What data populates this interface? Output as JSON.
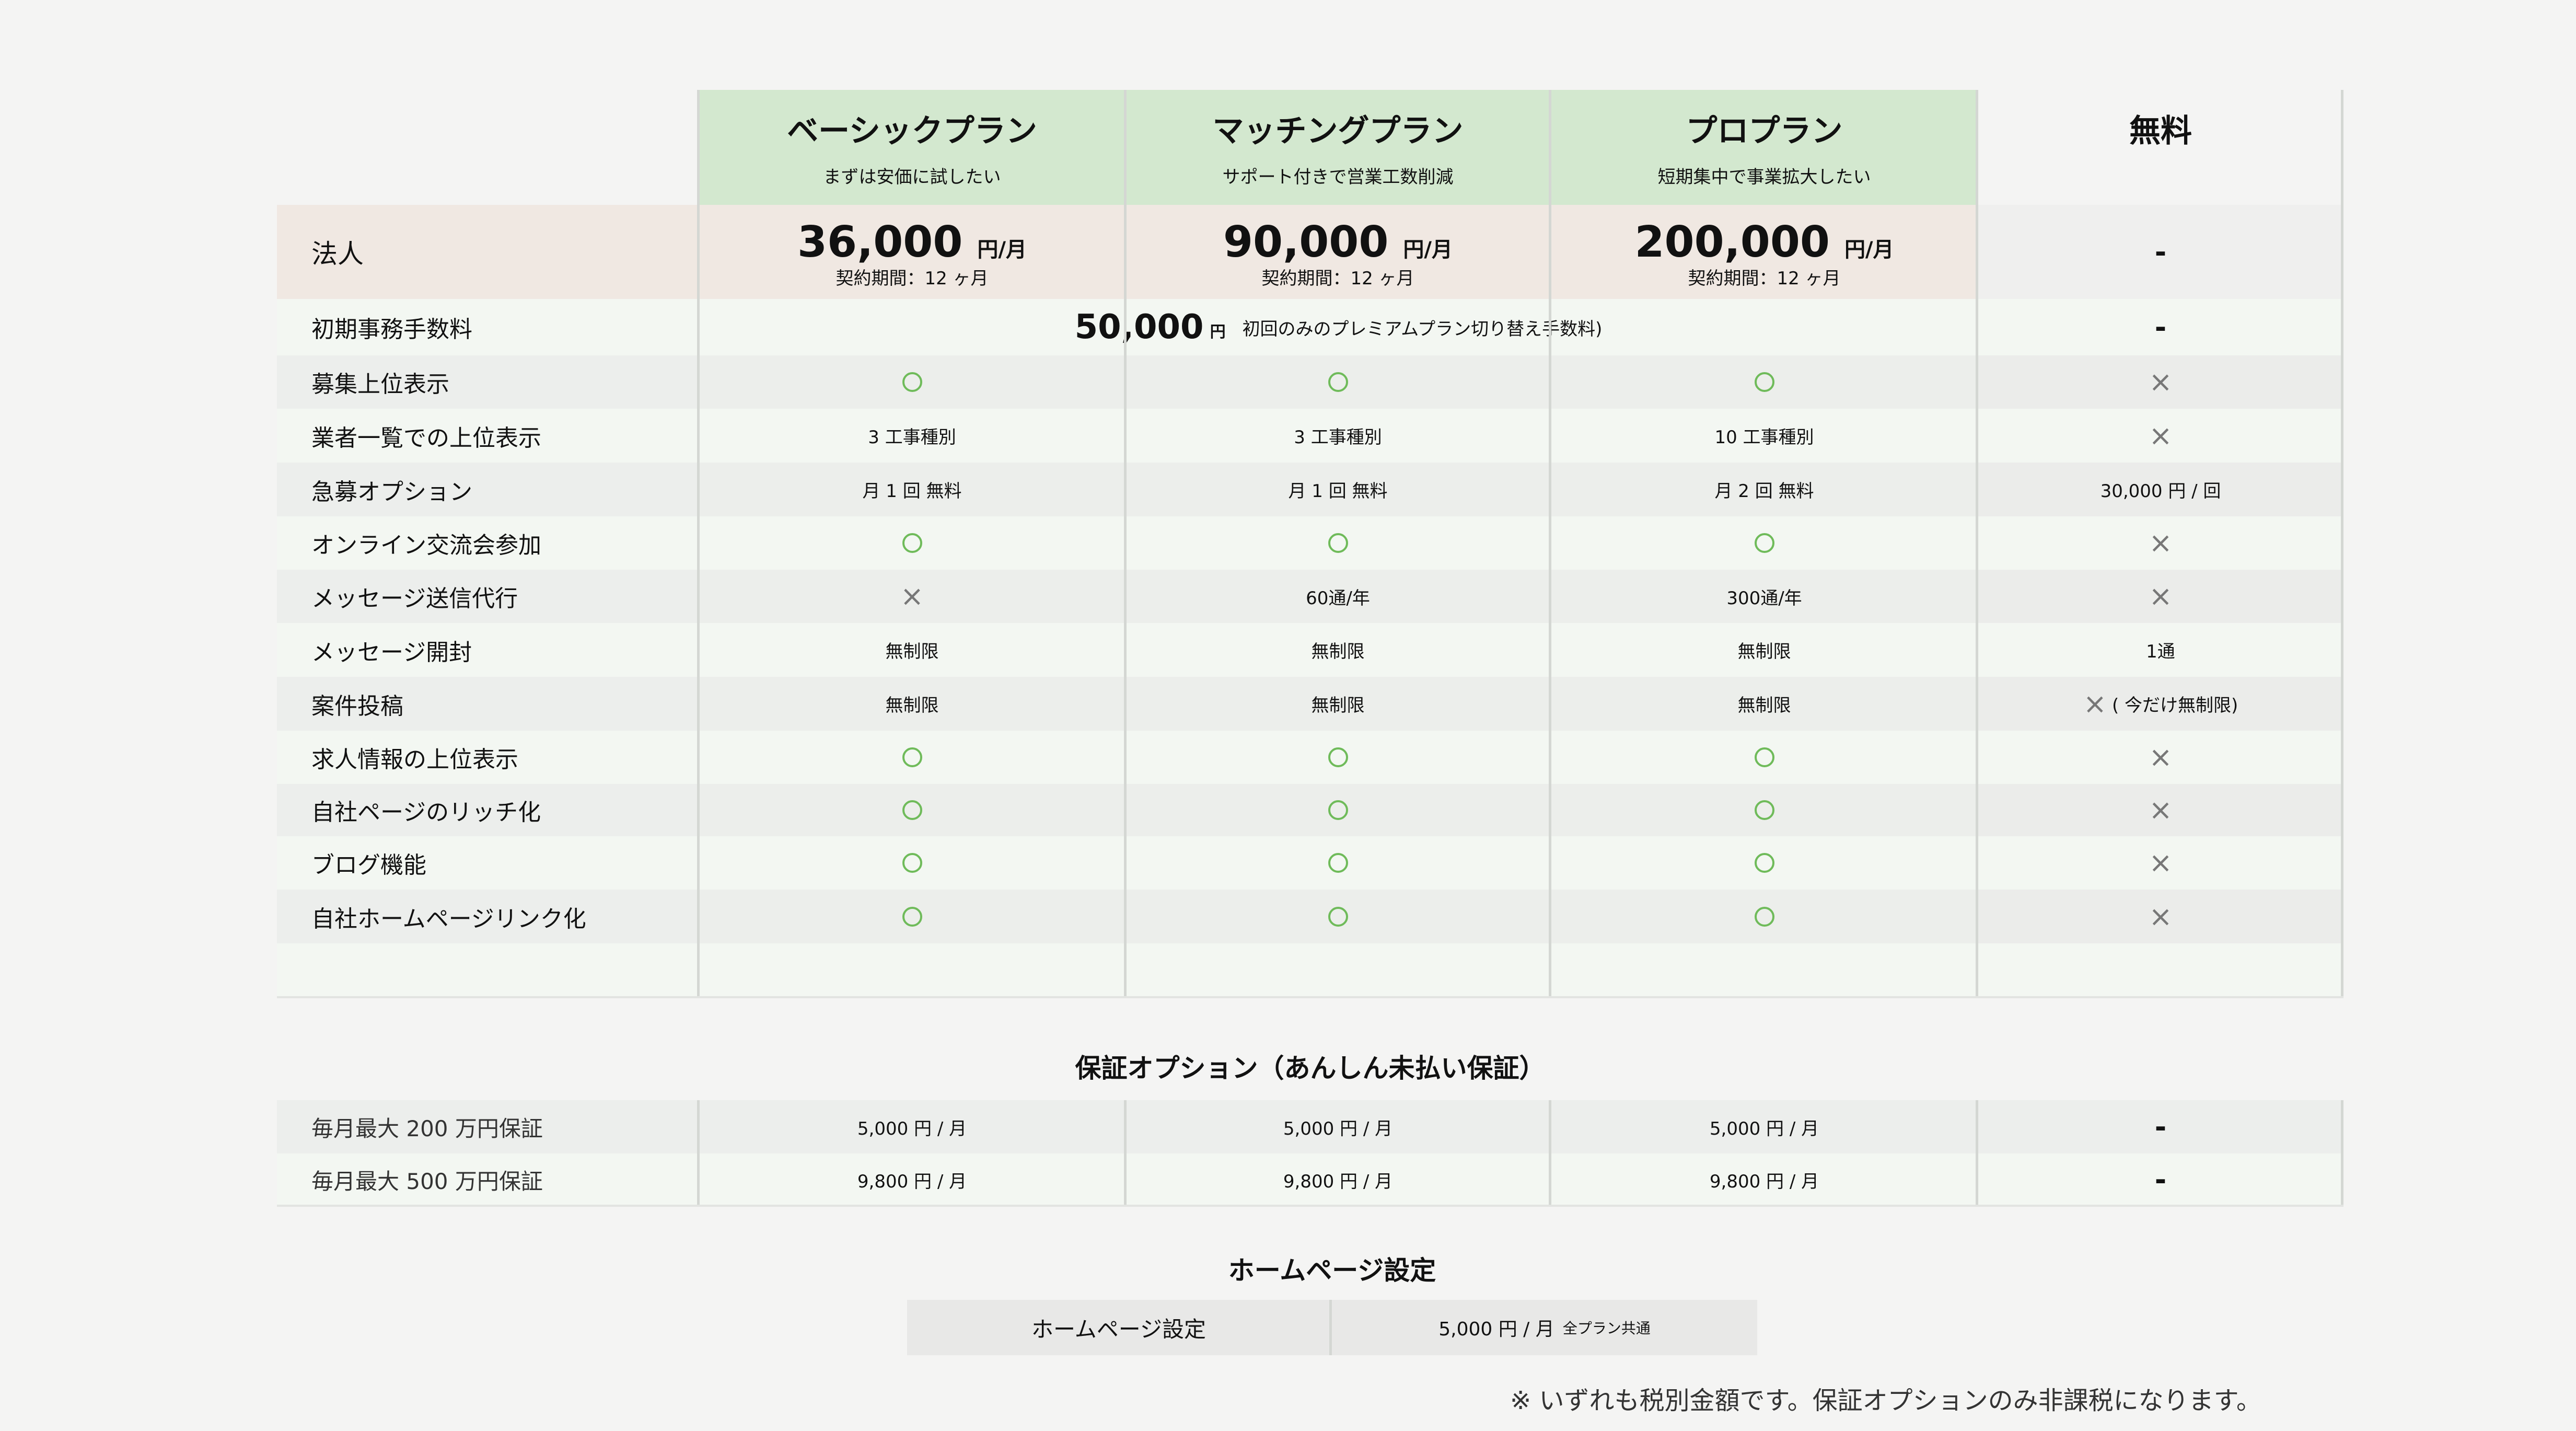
{
  "plans": [
    {
      "name": "ベーシックプラン",
      "subtitle": "まずは安価に試したい",
      "price": "36,000",
      "price_unit": "円/月",
      "term": "契約期間：12 ヶ月"
    },
    {
      "name": "マッチングプラン",
      "subtitle": "サポート付きで営業工数削減",
      "price": "90,000",
      "price_unit": "円/月",
      "term": "契約期間：12 ヶ月"
    },
    {
      "name": "プロプラン",
      "subtitle": "短期集中で事業拡大したい",
      "price": "200,000",
      "price_unit": "円/月",
      "term": "契約期間：12 ヶ月"
    }
  ],
  "free_plan": {
    "name": "無料",
    "price": "-"
  },
  "price_row_label": "法人",
  "initial_fee": {
    "label": "初期事務手数料",
    "amount": "50,000",
    "yen": "円",
    "note": "初回のみのプレミアムプラン切り替え手数料)",
    "free_value": "-"
  },
  "features": [
    {
      "label": "募集上位表示",
      "values": [
        "○",
        "○",
        "○",
        "×"
      ]
    },
    {
      "label": "業者一覧での上位表示",
      "values": [
        "3 工事種別",
        "3 工事種別",
        "10 工事種別",
        "×"
      ]
    },
    {
      "label": "急募オプション",
      "values": [
        "月 1 回 無料",
        "月 1 回 無料",
        "月 2 回 無料",
        "30,000 円 / 回"
      ]
    },
    {
      "label": "オンライン交流会参加",
      "values": [
        "○",
        "○",
        "○",
        "×"
      ]
    },
    {
      "label": "メッセージ送信代行",
      "values": [
        "×",
        "60通/年",
        "300通/年",
        "×"
      ]
    },
    {
      "label": "メッセージ開封",
      "values": [
        "無制限",
        "無制限",
        "無制限",
        "1通"
      ]
    },
    {
      "label": "案件投稿",
      "values": [
        "無制限",
        "無制限",
        "無制限",
        "( 今だけ無制限)"
      ]
    },
    {
      "label": "求人情報の上位表示",
      "values": [
        "○",
        "○",
        "○",
        "×"
      ]
    },
    {
      "label": "自社ページのリッチ化",
      "values": [
        "○",
        "○",
        "○",
        "×"
      ]
    },
    {
      "label": "ブログ機能",
      "values": [
        "○",
        "○",
        "○",
        "×"
      ]
    },
    {
      "label": "自社ホームページリンク化",
      "values": [
        "○",
        "○",
        "○",
        "×"
      ]
    }
  ],
  "guarantee": {
    "title": "保証オプション（あんしん未払い保証）",
    "rows": [
      {
        "label": "毎月最大 200 万円保証",
        "values": [
          "5,000 円 / 月",
          "5,000 円 / 月",
          "5,000 円 / 月",
          "-"
        ]
      },
      {
        "label": "毎月最大 500 万円保証",
        "values": [
          "9,800 円 / 月",
          "9,800 円 / 月",
          "9,800 円 / 月",
          "-"
        ]
      }
    ]
  },
  "homepage": {
    "title": "ホームページ設定",
    "label": "ホームページ設定",
    "value": "5,000 円 / 月",
    "note": "全プラン共通"
  },
  "footnote": "※ いずれも税別金額です。保証オプションのみ非課税になります。",
  "colors": {
    "plan_header": "#d3e8cf",
    "price_band": "#f0e8e2",
    "circle": "#6fbb5a",
    "cross": "#777777"
  }
}
